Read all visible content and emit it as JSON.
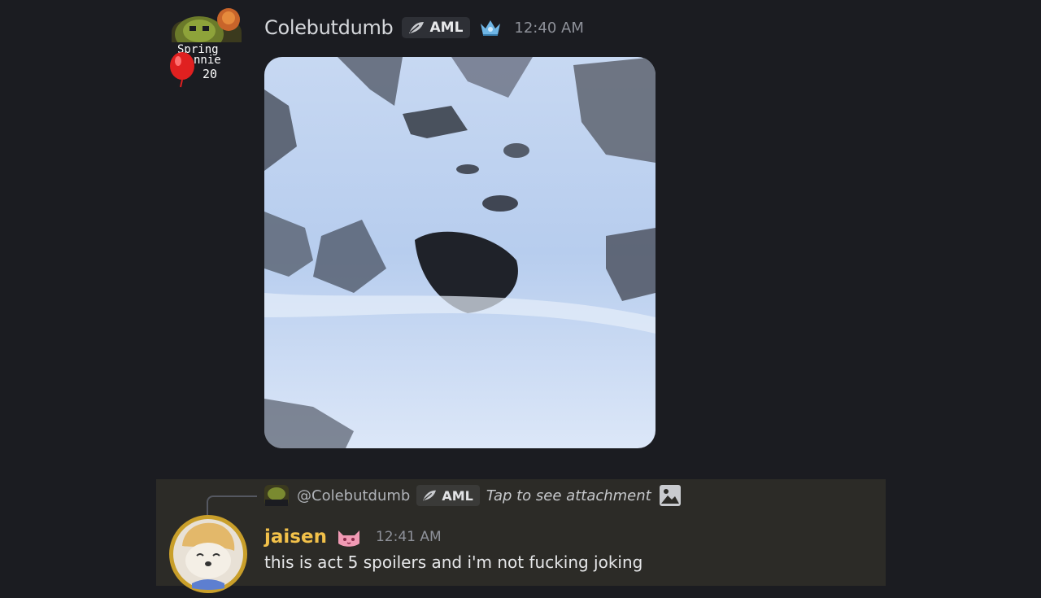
{
  "message1": {
    "username": "Colebutdumb",
    "tag_label": "AML",
    "timestamp": "12:40 AM",
    "avatar_text": [
      "Spring",
      "nnie",
      "20"
    ],
    "badge_icon": "crown-icon",
    "attachment": "video-thumbnail-snowy-mountain"
  },
  "message2": {
    "reply": {
      "username": "@Colebutdumb",
      "tag_label": "AML",
      "text": "Tap to see attachment",
      "icon": "image-icon"
    },
    "username": "jaisen",
    "badge_icon": "cat-icon",
    "timestamp": "12:41 AM",
    "text": "this is act 5 spoilers and i'm not fucking joking"
  },
  "colors": {
    "background": "#1b1c21",
    "highlight_row": "#2c2b27",
    "username2": "#f2c14a",
    "tag_bg": "#2e3036"
  }
}
